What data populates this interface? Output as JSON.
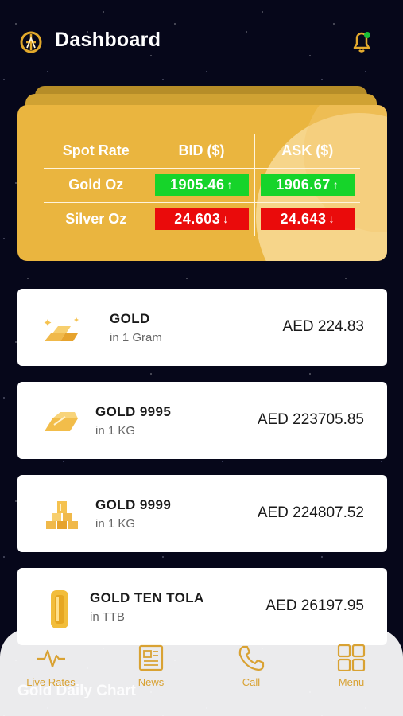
{
  "header": {
    "title": "Dashboard"
  },
  "spot": {
    "headers": [
      "Spot Rate",
      "BID ($)",
      "ASK ($)"
    ],
    "rows": [
      {
        "label": "Gold Oz",
        "bid": "1905.46",
        "ask": "1906.67",
        "bid_arrow": "↑",
        "ask_arrow": "↑"
      },
      {
        "label": "Silver Oz",
        "bid": "24.603",
        "ask": "24.643",
        "bid_arrow": "↓",
        "ask_arrow": "↓"
      }
    ]
  },
  "products": [
    {
      "name": "GOLD",
      "unit": "in 1 Gram",
      "price": "AED 224.83"
    },
    {
      "name": "GOLD 9995",
      "unit": "in 1 KG",
      "price": "AED 223705.85"
    },
    {
      "name": "GOLD 9999",
      "unit": "in 1 KG",
      "price": "AED 224807.52"
    },
    {
      "name": "GOLD TEN TOLA",
      "unit": "in TTB",
      "price": "AED 26197.95"
    }
  ],
  "ticker": "Gold Daily Chart",
  "nav": [
    {
      "label": "Live Rates",
      "icon": "pulse-icon"
    },
    {
      "label": "News",
      "icon": "newspaper-icon"
    },
    {
      "label": "Call",
      "icon": "phone-icon"
    },
    {
      "label": "Menu",
      "icon": "grid-icon"
    }
  ],
  "colors": {
    "gold": "#eab53f",
    "up": "#16d42a",
    "down": "#ea0b0b",
    "nav_accent": "#d9a233"
  }
}
